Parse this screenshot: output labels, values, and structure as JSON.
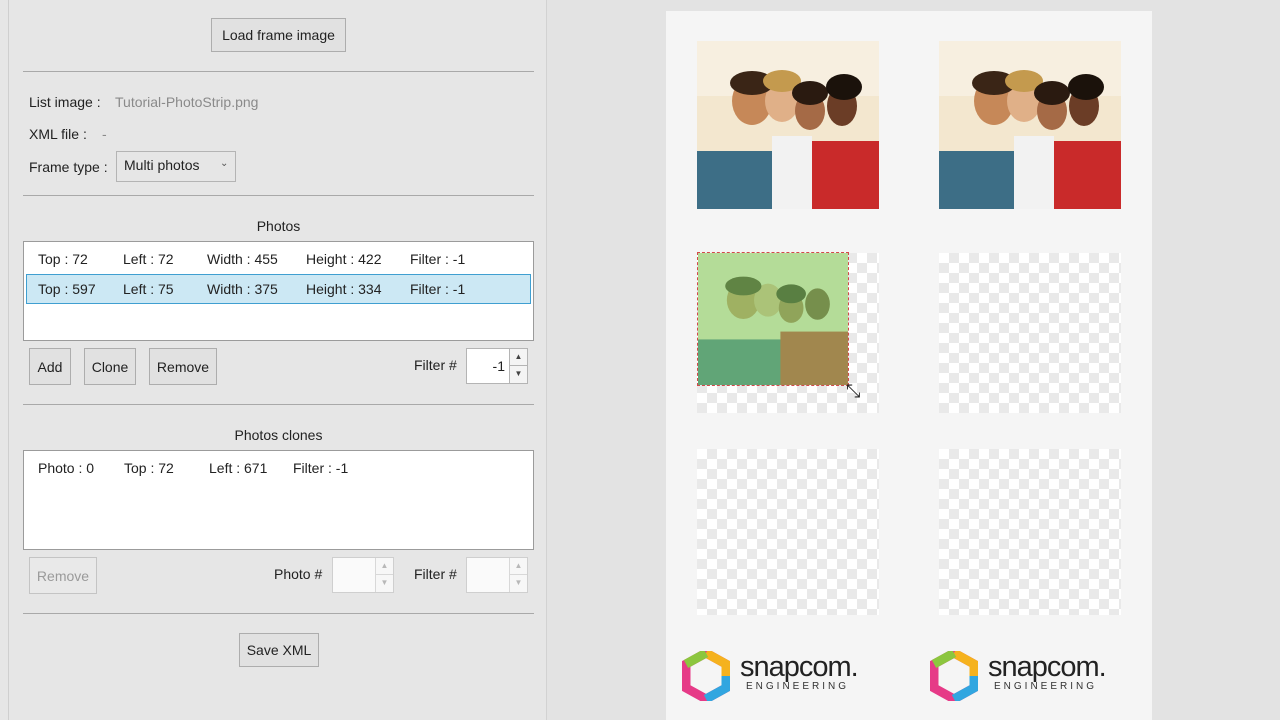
{
  "toolbar": {
    "load_label": "Load frame image"
  },
  "info": {
    "list_image_label": "List image :",
    "list_image_value": "Tutorial-PhotoStrip.png",
    "xml_file_label": "XML file :",
    "xml_file_value": "-",
    "frame_type_label": "Frame type :",
    "frame_type_value": "Multi photos"
  },
  "photos": {
    "title": "Photos",
    "rows": [
      {
        "top": "Top : 72",
        "left": "Left : 72",
        "width": "Width : 455",
        "height": "Height : 422",
        "filter": "Filter : -1"
      },
      {
        "top": "Top : 597",
        "left": "Left : 75",
        "width": "Width : 375",
        "height": "Height : 334",
        "filter": "Filter : -1"
      }
    ],
    "add_label": "Add",
    "clone_label": "Clone",
    "remove_label": "Remove",
    "filter_label": "Filter #",
    "filter_value": "-1"
  },
  "clones": {
    "title": "Photos clones",
    "rows": [
      {
        "photo": "Photo : 0",
        "top": "Top : 72",
        "left": "Left : 671",
        "filter": "Filter : -1"
      }
    ],
    "remove_label": "Remove",
    "photo_label": "Photo #",
    "photo_value": "",
    "filter_label": "Filter #",
    "filter_value": ""
  },
  "save_label": "Save XML",
  "logo": {
    "brand": "snapcom.",
    "sub": "ENGINEERING"
  },
  "colors": {
    "selection": "#cce8f4",
    "selection_border": "#3f9fd1",
    "overlay": "#7fd36b"
  }
}
